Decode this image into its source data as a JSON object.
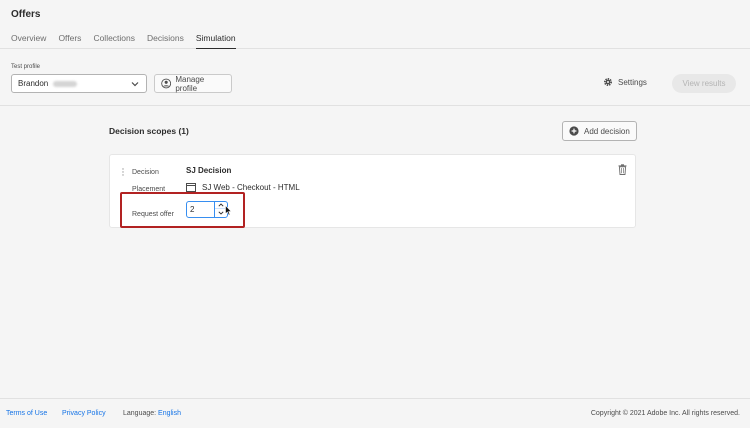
{
  "header": {
    "title": "Offers",
    "tabs": [
      {
        "label": "Overview"
      },
      {
        "label": "Offers"
      },
      {
        "label": "Collections"
      },
      {
        "label": "Decisions"
      },
      {
        "label": "Simulation"
      }
    ],
    "active_tab": "Simulation"
  },
  "profile_bar": {
    "test_profile_label": "Test profile",
    "selected_profile": "Brandon",
    "manage_profile_label": "Manage profile",
    "settings_label": "Settings",
    "view_results_label": "View results"
  },
  "decision_scopes": {
    "title": "Decision scopes (1)",
    "add_decision_label": "Add decision",
    "scope": {
      "decision_label": "Decision",
      "decision_value": "SJ Decision",
      "placement_label": "Placement",
      "placement_value": "SJ Web - Checkout - HTML",
      "request_offer_label": "Request offer",
      "request_offer_value": "2"
    }
  },
  "footer": {
    "terms_label": "Terms of Use",
    "privacy_label": "Privacy Policy",
    "language_label": "Language:",
    "language_value": "English",
    "copyright": "Copyright © 2021 Adobe Inc. All rights reserved."
  },
  "colors": {
    "accent_blue": "#1473e6",
    "highlight_red": "#b22222",
    "stepper_focus": "#378ef0"
  },
  "icons": [
    "chevron-down-icon",
    "user-circle-icon",
    "gear-icon",
    "add-circle-icon",
    "drag-handle-icon",
    "placement-icon",
    "chevron-up-icon",
    "trash-icon",
    "mouse-cursor-icon"
  ]
}
